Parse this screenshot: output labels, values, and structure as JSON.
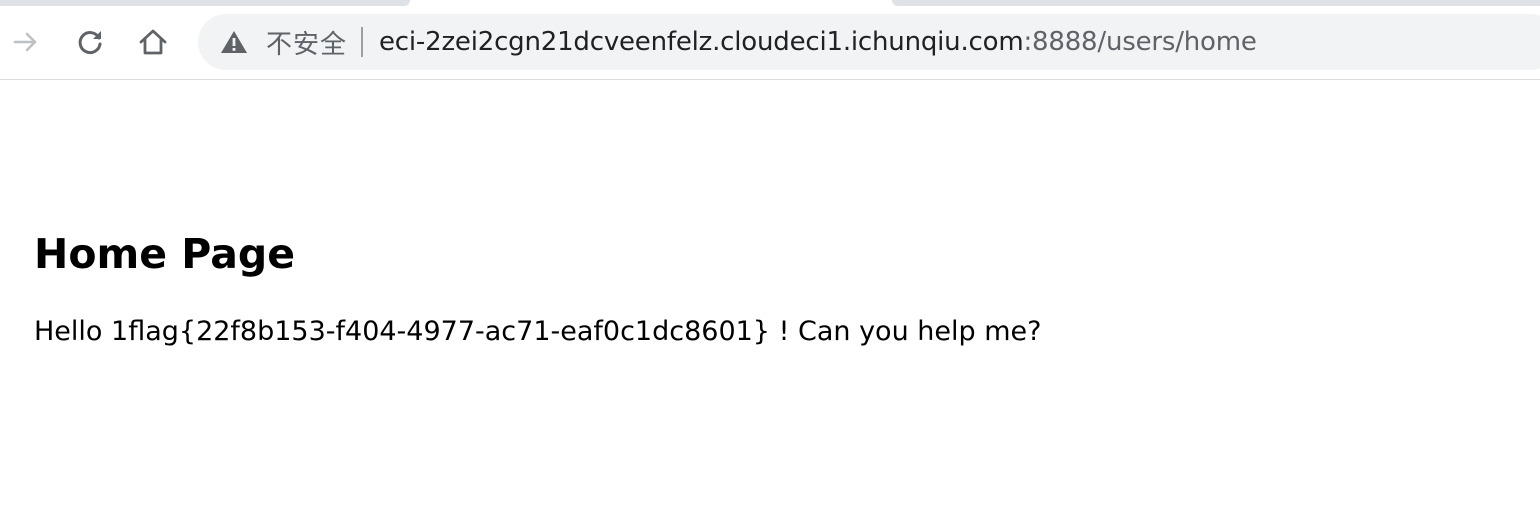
{
  "browser": {
    "security_label": "不安全",
    "url_host": "eci-2zei2cgn21dcveenfelz.cloudeci1.ichunqiu.com",
    "url_rest": ":8888/users/home",
    "icons": {
      "forward": "arrow-forward-icon",
      "reload": "reload-icon",
      "home": "home-icon",
      "security": "warning-triangle-icon"
    }
  },
  "page": {
    "title": "Home Page",
    "message": "Hello 1flag{22f8b153-f404-4977-ac71-eaf0c1dc8601} ! Can you help me?"
  },
  "colors": {
    "omnibox_bg": "#f1f3f4",
    "icon_gray": "#5f6368",
    "disabled_icon": "#bdc1c6"
  }
}
